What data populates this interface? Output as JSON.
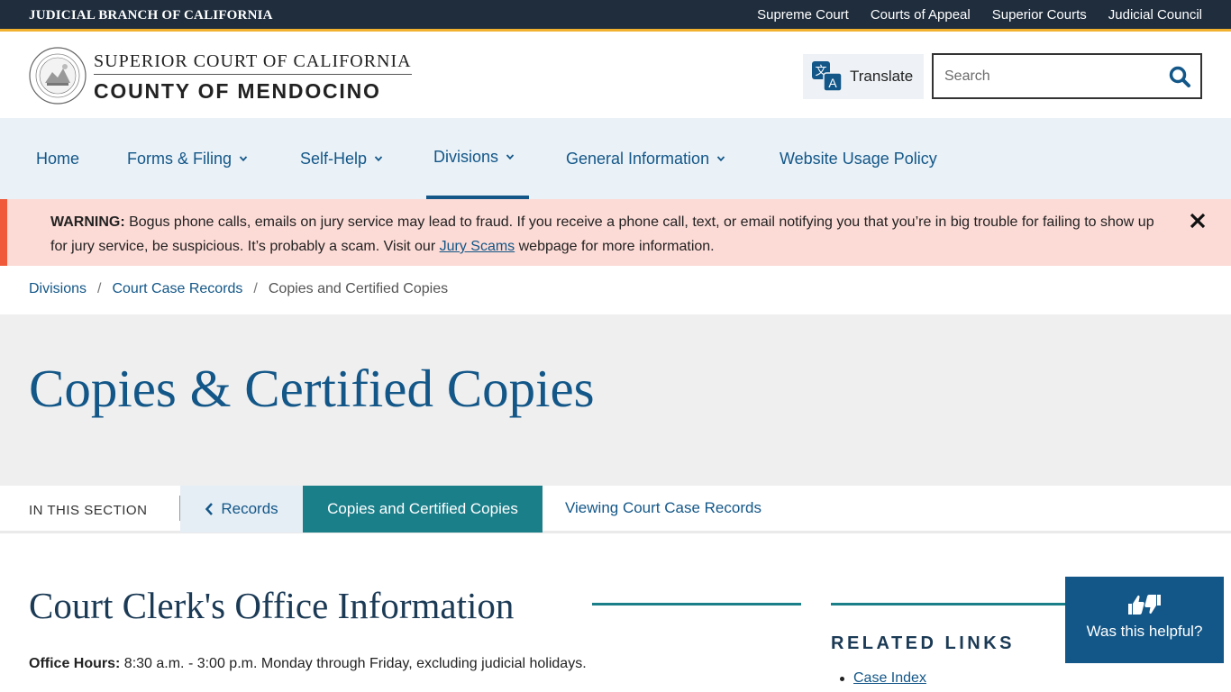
{
  "topbar": {
    "brand": "JUDICIAL BRANCH OF CALIFORNIA",
    "links": [
      "Supreme Court",
      "Courts of Appeal",
      "Superior Courts",
      "Judicial Council"
    ]
  },
  "header": {
    "logo_line1": "SUPERIOR COURT OF CALIFORNIA",
    "logo_line2": "COUNTY OF MENDOCINO",
    "translate_label": "Translate",
    "search_placeholder": "Search"
  },
  "nav": {
    "items": [
      {
        "label": "Home"
      },
      {
        "label": "Forms & Filing"
      },
      {
        "label": "Self-Help"
      },
      {
        "label": "Divisions"
      },
      {
        "label": "General Information"
      },
      {
        "label": "Website Usage Policy"
      }
    ]
  },
  "alert": {
    "label": "WARNING:",
    "text_before": " Bogus phone calls, emails on jury service may lead to fraud.  If you receive a phone call, text, or email notifying you that you’re in big trouble for failing to show up for jury service, be suspicious.  It’s probably a scam.  Visit our ",
    "link": "Jury Scams",
    "text_after": " webpage for more information."
  },
  "breadcrumb": {
    "items": [
      "Divisions",
      "Court Case Records"
    ],
    "separator": "/",
    "current": "Copies and Certified Copies"
  },
  "page": {
    "title": "Copies & Certified Copies"
  },
  "section_nav": {
    "label": "IN THIS SECTION",
    "back": "Records",
    "current": "Copies and Certified Copies",
    "other": "Viewing Court Case Records"
  },
  "content": {
    "heading": "Court Clerk's Office Information",
    "office_hours_label": "Office Hours:",
    "office_hours_text": " 8:30 a.m. - 3:00 p.m. Monday through Friday, excluding judicial holidays."
  },
  "related": {
    "title": "RELATED LINKS",
    "links": [
      "Case Index"
    ]
  },
  "feedback": {
    "label": "Was this helpful?"
  },
  "colors": {
    "topbar": "#1f2d3d",
    "accent_gold": "#f2b230",
    "link_blue": "#135788",
    "teal": "#1b7f8a",
    "alert_bg": "#fcdad5",
    "alert_border": "#f05a3a"
  }
}
